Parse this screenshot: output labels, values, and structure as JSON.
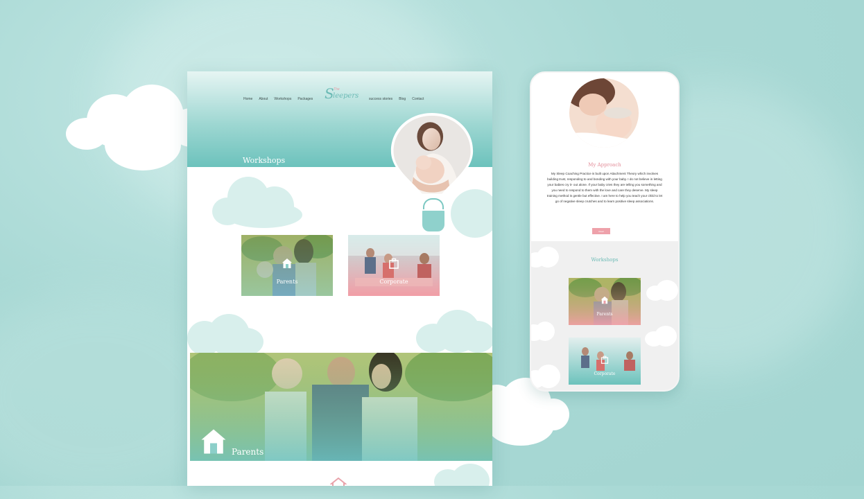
{
  "desktop": {
    "nav_left": [
      "Home",
      "About",
      "Workshops",
      "Packages"
    ],
    "nav_right": [
      "success stories",
      "Blog",
      "Contact"
    ],
    "logo": {
      "small": "The",
      "initial": "S",
      "rest": "leepers"
    },
    "hero_title": "Workshops",
    "cards": [
      {
        "label": "Parents",
        "icon": "house-icon"
      },
      {
        "label": "Corporate",
        "icon": "briefcase-icon"
      }
    ],
    "band_label": "Parents",
    "band_icon": "house-icon"
  },
  "phone": {
    "title": "My Approach",
    "body": "My Sleep Coaching Practice is built upon Attachment Theory which involves building trust, responding to and bonding with your baby. I do not believe in letting your babies cry it- out alone. If your baby cries they are telling you something and you need to respond to them with the love and care they deserve. My sleep training method is gentle but effective. I am here to help you teach your child to let go of negative sleep crutches and to learn positive sleep associations.",
    "button": "Read more",
    "workshops_title": "Workshops",
    "cards": [
      {
        "label": "Parents",
        "icon": "house-icon"
      },
      {
        "label": "Corporate",
        "icon": "briefcase-icon"
      }
    ]
  },
  "colors": {
    "teal": "#6bbab5",
    "pink": "#e38e9a",
    "background": "#a9d9d5"
  }
}
